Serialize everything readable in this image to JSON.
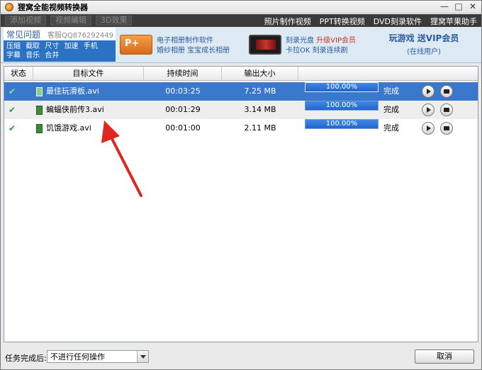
{
  "window": {
    "title": "狸窝全能视频转换器"
  },
  "toolbar": {
    "buttons": [
      "添加视频",
      "视频编辑",
      "3D效果"
    ],
    "links": [
      "照片制作视频",
      "PPT转换视频",
      "DVD刻录软件",
      "狸窝苹果助手"
    ]
  },
  "banner": {
    "faq_title": "常见问题",
    "faq_service": "客服QQ876292449",
    "faq_links_line1": [
      "压缩",
      "截取",
      "尺寸",
      "加速",
      "手机"
    ],
    "faq_links_line2": [
      "字幕",
      "音乐",
      "合并"
    ],
    "promo1_line1": "电子相册制作软件",
    "promo1_line2": "婚纱相册 宝宝成长相册",
    "promo2_line1_a": "刻录光盘",
    "promo2_line1_b": "升级VIP会员",
    "promo2_line2": "卡拉OK 刻录连续剧",
    "game_title": "玩游戏 送VIP会员",
    "game_sub": "(在线用户)"
  },
  "table": {
    "headers": [
      "状态",
      "目标文件",
      "持续时间",
      "输出大小"
    ],
    "rows": [
      {
        "file": "最佳玩滑板.avi",
        "duration": "00:03:25",
        "size": "7.25 MB",
        "progress": "100.00%",
        "progress_value": 1.0,
        "state": "完成"
      },
      {
        "file": "蝙蝠侠前传3.avi",
        "duration": "00:01:29",
        "size": "3.14 MB",
        "progress": "100.00%",
        "progress_value": 1.0,
        "state": "完成"
      },
      {
        "file": "饥饿游戏.avi",
        "duration": "00:01:00",
        "size": "2.11 MB",
        "progress": "100.00%",
        "progress_value": 1.0,
        "state": "完成"
      }
    ]
  },
  "bottom": {
    "task_label": "任务完成后:",
    "select_value": "不进行任何操作",
    "cancel_label": "取消"
  },
  "colors": {
    "selected_row": "#3a78cc",
    "progress_fill": "#2266cc",
    "arrow": "#e0261f"
  }
}
